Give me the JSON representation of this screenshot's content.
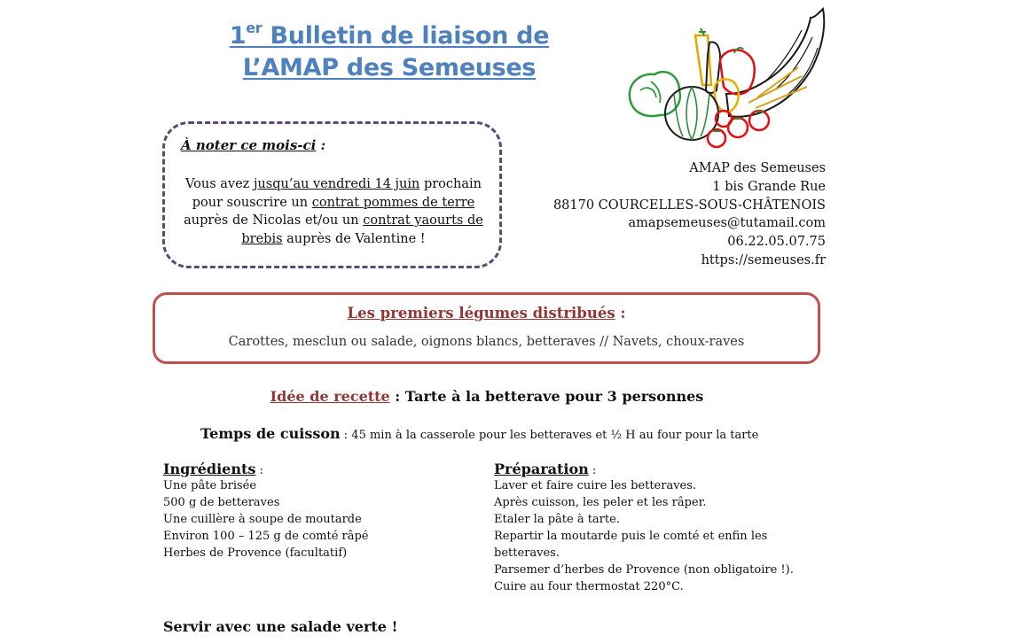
{
  "header": {
    "title_sup": "er",
    "title_line1": "Bulletin de liaison de",
    "title_num": "1",
    "title_line2": "L’AMAP des Semeuses"
  },
  "note": {
    "heading": "À noter ce mois-ci",
    "heading_colon": " :",
    "text_1": "Vous avez ",
    "text_deadline": "jusqu’au vendredi 14 juin",
    "text_2": " prochain pour souscrire un ",
    "text_contract1": "contrat pommes de terre",
    "text_3": " auprès de Nicolas et/ou un ",
    "text_contract2": "contrat yaourts de brebis",
    "text_4": " auprès de Valentine !"
  },
  "address": {
    "name": "AMAP des Semeuses",
    "street": "1 bis Grande Rue",
    "city": "88170 COURCELLES-SOUS-CHÂTENOIS",
    "email": "amapsemeuses@tutamail.com",
    "phone": "06.22.05.07.75",
    "website": "https://semeuses.fr"
  },
  "vegetables": {
    "title": "Les premiers légumes distribués",
    "title_colon": " :",
    "list": "Carottes, mesclun ou salade, oignons blancs, betteraves // Navets, choux-raves"
  },
  "recipe": {
    "label": "Idée de recette",
    "name": " : Tarte à la betterave pour 3 personnes",
    "cook_label": "Temps de cuisson",
    "cook_value": " : 45 min à la casserole pour les betteraves et ½ H au four pour la tarte",
    "ingredients_heading": "Ingrédients",
    "ingredients": [
      "Une pâte brisée",
      "500 g de betteraves",
      "Une cuillère à soupe de moutarde",
      "Environ 100 – 125 g de comté râpé",
      "Herbes de Provence (facultatif)"
    ],
    "preparation_heading": "Préparation",
    "preparation": [
      "Laver et faire cuire les betteraves.",
      "Après cuisson, les peler et les râper.",
      "Etaler la pâte à tarte.",
      "Repartir la moutarde puis le comté et enfin les",
      "betteraves.",
      "Parsemer d’herbes de Provence (non obligatoire !).",
      "Cuire au four thermostat 220°C."
    ],
    "colon": " :",
    "serve": "Servir avec une salade verte !"
  },
  "colors": {
    "title_blue": "#4f81bd",
    "note_border": "#5b4a78",
    "veg_border": "#c0504d",
    "accent_red": "#943634"
  },
  "icons": [
    "cornucopia-vegetables-illustration"
  ]
}
